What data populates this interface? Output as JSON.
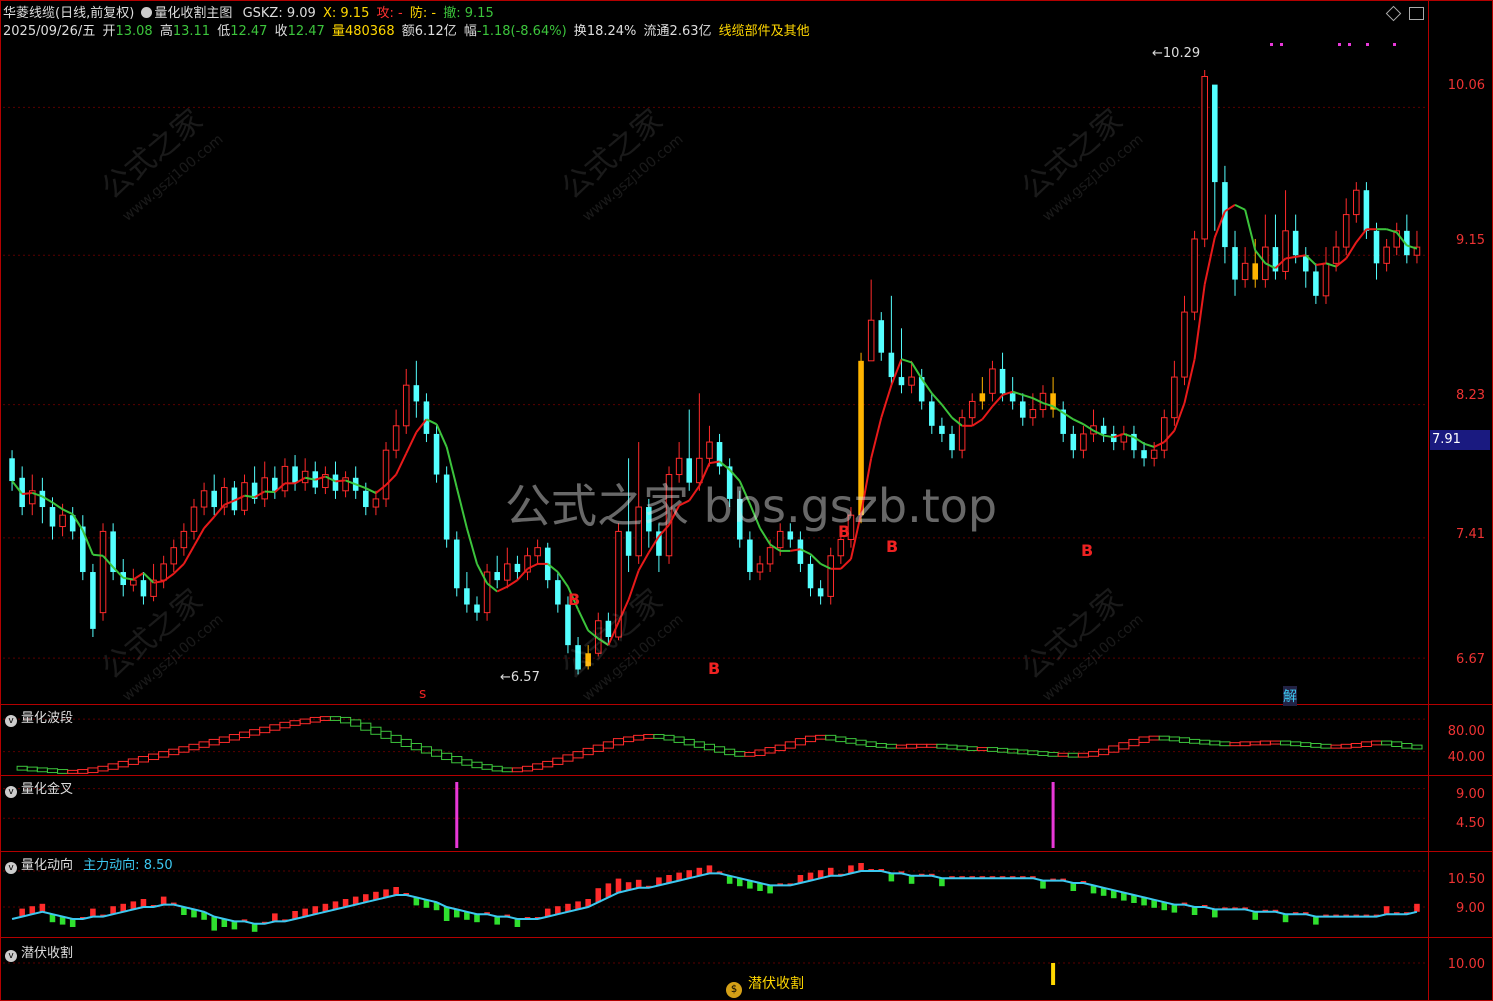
{
  "header": {
    "title": "华菱线缆(日线,前复权)",
    "indicator": "量化收割主图",
    "gskz_label": "GSKZ:",
    "gskz_value": "9.09",
    "x_label": "X:",
    "x_value": "9.15",
    "gong_label": "攻:",
    "gong_value": "-",
    "fang_label": "防:",
    "fang_value": "-",
    "che_label": "撤:",
    "che_value": "9.15",
    "date": "2025/09/26/五",
    "open_label": "开",
    "open": "13.08",
    "high_label": "高",
    "high": "13.11",
    "low_label": "低",
    "low": "12.47",
    "close_label": "收",
    "close": "12.47",
    "vol_label": "量",
    "vol": "480368",
    "amt_label": "额",
    "amt": "6.12亿",
    "chg_label": "幅",
    "chg": "-1.18(-8.64%)",
    "turn_label": "换",
    "turn": "18.24%",
    "float_label": "流通",
    "float": "2.63亿",
    "sector": "线缆部件及其他"
  },
  "watermark": {
    "big": "公式之家 bbs.gszb.top",
    "small_cn": "公式之家",
    "small_url": "www.gszj100.com"
  },
  "colors": {
    "up": "#ff2b2b",
    "down": "#54ffff",
    "signal": "#ffb400",
    "ma_up": "#e81a1a",
    "ma_down": "#3cc43c",
    "axis": "#b30000",
    "magenta": "#e838d8",
    "cyan_line": "#3cc8f0",
    "yellow": "#ffd700"
  },
  "main_panel": {
    "y_ticks": [
      "10.06",
      "9.15",
      "8.23",
      "7.41",
      "6.67"
    ],
    "current_price": "7.91",
    "high_annotation": "10.29",
    "low_annotation": "6.57",
    "bottom_labels": {
      "s": "s",
      "jie": "解"
    },
    "markers": [
      "B",
      "B",
      "B",
      "B",
      "B"
    ]
  },
  "sub_panels": [
    {
      "title": "量化波段",
      "ticks": [
        "80.00",
        "40.00"
      ]
    },
    {
      "title": "量化金叉",
      "ticks": [
        "9.00",
        "4.50"
      ]
    },
    {
      "title": "量化动向",
      "extra_label": "主力动向:",
      "extra_value": "8.50",
      "ticks": [
        "10.50",
        "9.00"
      ]
    },
    {
      "title": "潜伏收割",
      "ticks": [
        "10.00"
      ],
      "signal_text": "潜伏收割"
    }
  ],
  "chart_data": {
    "type": "candlestick",
    "x_count": 140,
    "ylim": [
      6.4,
      10.45
    ],
    "ylabel": "",
    "y_ticks": [
      10.06,
      9.15,
      8.23,
      7.41,
      6.67
    ],
    "candles": [
      [
        7.9,
        7.76,
        7.95,
        7.7
      ],
      [
        7.78,
        7.6,
        7.85,
        7.55
      ],
      [
        7.62,
        7.7,
        7.8,
        7.55
      ],
      [
        7.7,
        7.6,
        7.78,
        7.5
      ],
      [
        7.6,
        7.48,
        7.66,
        7.4
      ],
      [
        7.48,
        7.55,
        7.62,
        7.42
      ],
      [
        7.55,
        7.45,
        7.6,
        7.4
      ],
      [
        7.48,
        7.2,
        7.55,
        7.15
      ],
      [
        7.2,
        6.85,
        7.25,
        6.8
      ],
      [
        6.95,
        7.45,
        7.5,
        6.9
      ],
      [
        7.45,
        7.2,
        7.5,
        7.15
      ],
      [
        7.2,
        7.12,
        7.28,
        7.05
      ],
      [
        7.12,
        7.15,
        7.22,
        7.08
      ],
      [
        7.15,
        7.05,
        7.2,
        7.0
      ],
      [
        7.05,
        7.15,
        7.25,
        7.02
      ],
      [
        7.15,
        7.25,
        7.3,
        7.1
      ],
      [
        7.25,
        7.35,
        7.4,
        7.2
      ],
      [
        7.35,
        7.45,
        7.5,
        7.3
      ],
      [
        7.45,
        7.6,
        7.65,
        7.4
      ],
      [
        7.6,
        7.7,
        7.75,
        7.55
      ],
      [
        7.7,
        7.6,
        7.8,
        7.55
      ],
      [
        7.6,
        7.72,
        7.78,
        7.55
      ],
      [
        7.72,
        7.58,
        7.76,
        7.55
      ],
      [
        7.58,
        7.75,
        7.8,
        7.55
      ],
      [
        7.75,
        7.65,
        7.85,
        7.62
      ],
      [
        7.65,
        7.78,
        7.88,
        7.6
      ],
      [
        7.78,
        7.7,
        7.85,
        7.65
      ],
      [
        7.7,
        7.85,
        7.9,
        7.66
      ],
      [
        7.85,
        7.75,
        7.92,
        7.7
      ],
      [
        7.75,
        7.82,
        7.9,
        7.7
      ],
      [
        7.82,
        7.72,
        7.88,
        7.68
      ],
      [
        7.72,
        7.8,
        7.85,
        7.68
      ],
      [
        7.8,
        7.7,
        7.88,
        7.65
      ],
      [
        7.7,
        7.78,
        7.82,
        7.66
      ],
      [
        7.78,
        7.7,
        7.85,
        7.65
      ],
      [
        7.7,
        7.6,
        7.75,
        7.55
      ],
      [
        7.6,
        7.65,
        7.7,
        7.55
      ],
      [
        7.65,
        7.95,
        8.0,
        7.6
      ],
      [
        7.95,
        8.1,
        8.2,
        7.9
      ],
      [
        8.1,
        8.35,
        8.45,
        8.05
      ],
      [
        8.35,
        8.25,
        8.5,
        8.15
      ],
      [
        8.25,
        8.05,
        8.3,
        8.0
      ],
      [
        8.05,
        7.8,
        8.1,
        7.75
      ],
      [
        7.8,
        7.4,
        7.85,
        7.35
      ],
      [
        7.4,
        7.1,
        7.45,
        7.05
      ],
      [
        7.1,
        7.0,
        7.2,
        6.95
      ],
      [
        7.0,
        6.95,
        7.05,
        6.9
      ],
      [
        6.95,
        7.2,
        7.25,
        6.9
      ],
      [
        7.2,
        7.15,
        7.3,
        7.1
      ],
      [
        7.15,
        7.25,
        7.35,
        7.1
      ],
      [
        7.25,
        7.2,
        7.3,
        7.15
      ],
      [
        7.2,
        7.3,
        7.35,
        7.15
      ],
      [
        7.3,
        7.35,
        7.4,
        7.25
      ],
      [
        7.35,
        7.15,
        7.38,
        7.1
      ],
      [
        7.15,
        7.0,
        7.2,
        6.95
      ],
      [
        7.0,
        6.75,
        7.05,
        6.7
      ],
      [
        6.75,
        6.6,
        6.8,
        6.57
      ],
      [
        6.62,
        6.7,
        6.75,
        6.6
      ],
      [
        6.7,
        6.9,
        6.95,
        6.68
      ],
      [
        6.9,
        6.8,
        6.95,
        6.75
      ],
      [
        6.8,
        7.45,
        7.5,
        6.78
      ],
      [
        7.45,
        7.3,
        7.9,
        7.2
      ],
      [
        7.3,
        7.6,
        8.0,
        7.25
      ],
      [
        7.6,
        7.45,
        7.65,
        7.35
      ],
      [
        7.45,
        7.3,
        7.5,
        7.2
      ],
      [
        7.3,
        7.8,
        7.85,
        7.25
      ],
      [
        7.8,
        7.9,
        8.0,
        7.75
      ],
      [
        7.9,
        7.75,
        8.2,
        7.7
      ],
      [
        7.75,
        7.9,
        8.3,
        7.7
      ],
      [
        7.9,
        8.0,
        8.1,
        7.85
      ],
      [
        8.0,
        7.85,
        8.05,
        7.8
      ],
      [
        7.85,
        7.65,
        7.9,
        7.6
      ],
      [
        7.65,
        7.4,
        7.7,
        7.35
      ],
      [
        7.4,
        7.2,
        7.45,
        7.15
      ],
      [
        7.2,
        7.25,
        7.3,
        7.15
      ],
      [
        7.25,
        7.35,
        7.4,
        7.2
      ],
      [
        7.35,
        7.45,
        7.5,
        7.3
      ],
      [
        7.45,
        7.4,
        7.5,
        7.35
      ],
      [
        7.4,
        7.25,
        7.45,
        7.2
      ],
      [
        7.25,
        7.1,
        7.3,
        7.05
      ],
      [
        7.1,
        7.05,
        7.15,
        7.0
      ],
      [
        7.05,
        7.3,
        7.35,
        7.0
      ],
      [
        7.3,
        7.4,
        7.45,
        7.25
      ],
      [
        7.4,
        7.55,
        7.6,
        7.35
      ],
      [
        7.55,
        8.5,
        8.55,
        7.5
      ],
      [
        8.5,
        8.75,
        9.0,
        8.5
      ],
      [
        8.75,
        8.55,
        8.8,
        8.5
      ],
      [
        8.55,
        8.4,
        8.9,
        8.35
      ],
      [
        8.4,
        8.35,
        8.7,
        8.3
      ],
      [
        8.35,
        8.4,
        8.5,
        8.3
      ],
      [
        8.4,
        8.25,
        8.45,
        8.2
      ],
      [
        8.25,
        8.1,
        8.3,
        8.05
      ],
      [
        8.1,
        8.05,
        8.15,
        8.0
      ],
      [
        8.05,
        7.95,
        8.1,
        7.9
      ],
      [
        7.95,
        8.15,
        8.2,
        7.9
      ],
      [
        8.15,
        8.25,
        8.3,
        8.1
      ],
      [
        8.25,
        8.3,
        8.4,
        8.2
      ],
      [
        8.3,
        8.45,
        8.5,
        8.25
      ],
      [
        8.45,
        8.3,
        8.55,
        8.25
      ],
      [
        8.3,
        8.25,
        8.4,
        8.2
      ],
      [
        8.25,
        8.15,
        8.3,
        8.1
      ],
      [
        8.15,
        8.2,
        8.3,
        8.1
      ],
      [
        8.2,
        8.3,
        8.35,
        8.15
      ],
      [
        8.3,
        8.2,
        8.4,
        8.15
      ],
      [
        8.2,
        8.05,
        8.25,
        8.0
      ],
      [
        8.05,
        7.95,
        8.1,
        7.9
      ],
      [
        7.95,
        8.05,
        8.1,
        7.9
      ],
      [
        8.05,
        8.1,
        8.2,
        8.0
      ],
      [
        8.1,
        8.05,
        8.15,
        8.0
      ],
      [
        8.05,
        8.0,
        8.1,
        7.95
      ],
      [
        8.0,
        8.05,
        8.1,
        7.95
      ],
      [
        8.05,
        7.95,
        8.1,
        7.9
      ],
      [
        7.95,
        7.9,
        8.0,
        7.85
      ],
      [
        7.9,
        7.95,
        8.0,
        7.85
      ],
      [
        7.95,
        8.15,
        8.2,
        7.9
      ],
      [
        8.15,
        8.4,
        8.5,
        8.1
      ],
      [
        8.4,
        8.8,
        8.9,
        8.35
      ],
      [
        8.8,
        9.25,
        9.3,
        8.75
      ],
      [
        9.25,
        10.25,
        10.29,
        9.2
      ],
      [
        10.2,
        9.6,
        10.0,
        9.3
      ],
      [
        9.6,
        9.2,
        9.7,
        9.1
      ],
      [
        9.2,
        9.0,
        9.3,
        8.9
      ],
      [
        9.0,
        9.1,
        9.2,
        8.95
      ],
      [
        9.1,
        9.0,
        9.25,
        8.95
      ],
      [
        9.0,
        9.2,
        9.4,
        8.95
      ],
      [
        9.2,
        9.05,
        9.4,
        9.0
      ],
      [
        9.05,
        9.3,
        9.55,
        9.0
      ],
      [
        9.3,
        9.15,
        9.4,
        9.1
      ],
      [
        9.15,
        9.05,
        9.2,
        8.95
      ],
      [
        9.05,
        8.9,
        9.1,
        8.85
      ],
      [
        8.9,
        9.1,
        9.2,
        8.85
      ],
      [
        9.1,
        9.2,
        9.3,
        9.05
      ],
      [
        9.2,
        9.4,
        9.5,
        9.15
      ],
      [
        9.4,
        9.55,
        9.6,
        9.35
      ],
      [
        9.55,
        9.3,
        9.6,
        9.25
      ],
      [
        9.3,
        9.1,
        9.35,
        9.0
      ],
      [
        9.1,
        9.2,
        9.25,
        9.05
      ],
      [
        9.2,
        9.3,
        9.35,
        9.15
      ],
      [
        9.3,
        9.15,
        9.4,
        9.1
      ],
      [
        9.15,
        9.2,
        9.3,
        9.1
      ]
    ],
    "signal_indices": [
      57,
      84,
      96,
      103,
      123
    ],
    "series": [
      {
        "values": []
      }
    ],
    "sub_wave": [
      22,
      21,
      20,
      19,
      18,
      17,
      17,
      18,
      20,
      22,
      25,
      28,
      31,
      34,
      37,
      40,
      43,
      46,
      49,
      52,
      55,
      58,
      61,
      64,
      67,
      70,
      73,
      76,
      78,
      80,
      82,
      83,
      82,
      79,
      75,
      70,
      65,
      60,
      55,
      50,
      46,
      42,
      38,
      34,
      30,
      27,
      24,
      22,
      20,
      19,
      20,
      22,
      25,
      28,
      32,
      36,
      40,
      44,
      48,
      52,
      56,
      58,
      60,
      61,
      60,
      58,
      55,
      52,
      49,
      46,
      43,
      40,
      38,
      39,
      42,
      45,
      48,
      52,
      56,
      59,
      60,
      58,
      56,
      54,
      52,
      50,
      49,
      48,
      48,
      49,
      49,
      49,
      48,
      47,
      46,
      45,
      45,
      44,
      43,
      42,
      41,
      40,
      39,
      38,
      38,
      37,
      38,
      40,
      43,
      47,
      51,
      55,
      58,
      59,
      58,
      57,
      55,
      54,
      53,
      52,
      51,
      51,
      52,
      52,
      53,
      53,
      52,
      51,
      50,
      49,
      48,
      48,
      49,
      50,
      52,
      53,
      52,
      50,
      48,
      47
    ],
    "sub_cross_indices": [
      44,
      103
    ],
    "sub_dir": [
      8.5,
      8.6,
      8.7,
      8.8,
      8.7,
      8.6,
      8.5,
      8.5,
      8.6,
      8.6,
      8.7,
      8.8,
      8.9,
      9.0,
      9.0,
      9.1,
      9.1,
      9.0,
      8.9,
      8.8,
      8.6,
      8.5,
      8.4,
      8.4,
      8.3,
      8.3,
      8.4,
      8.4,
      8.5,
      8.6,
      8.7,
      8.8,
      8.9,
      9.0,
      9.1,
      9.2,
      9.3,
      9.4,
      9.5,
      9.5,
      9.4,
      9.3,
      9.2,
      9.0,
      8.9,
      8.8,
      8.7,
      8.7,
      8.6,
      8.6,
      8.5,
      8.5,
      8.5,
      8.6,
      8.7,
      8.8,
      8.9,
      9.0,
      9.2,
      9.4,
      9.6,
      9.7,
      9.8,
      9.8,
      9.9,
      10.0,
      10.1,
      10.2,
      10.3,
      10.4,
      10.4,
      10.3,
      10.2,
      10.1,
      10.0,
      9.9,
      9.9,
      9.9,
      10.0,
      10.1,
      10.2,
      10.3,
      10.3,
      10.4,
      10.5,
      10.5,
      10.5,
      10.4,
      10.4,
      10.3,
      10.3,
      10.3,
      10.2,
      10.2,
      10.2,
      10.2,
      10.2,
      10.2,
      10.2,
      10.2,
      10.2,
      10.2,
      10.1,
      10.1,
      10.1,
      10.0,
      10.0,
      9.9,
      9.8,
      9.7,
      9.6,
      9.5,
      9.4,
      9.3,
      9.2,
      9.1,
      9.1,
      9.0,
      9.0,
      8.9,
      8.9,
      8.9,
      8.9,
      8.8,
      8.8,
      8.8,
      8.7,
      8.7,
      8.7,
      8.6,
      8.6,
      8.6,
      8.6,
      8.6,
      8.6,
      8.6,
      8.7,
      8.7,
      8.7,
      8.8
    ],
    "latent_signal_index": 103
  }
}
